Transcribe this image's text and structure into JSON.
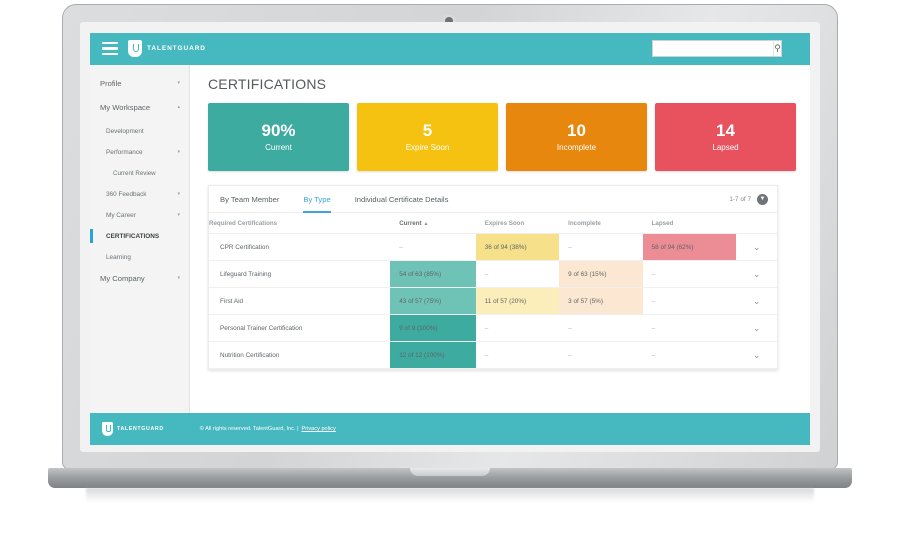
{
  "topbar": {
    "menu_icon": "hamburger-icon",
    "brand_icon": "shield-icon",
    "brand_name": "TALENTGUARD",
    "search_placeholder": "",
    "search_value": "",
    "search_icon": "search-icon"
  },
  "sidebar": {
    "items": [
      {
        "label": "Profile",
        "level": "top",
        "caret": "▾",
        "active": false
      },
      {
        "label": "My Workspace",
        "level": "top",
        "caret": "▴",
        "active": false
      },
      {
        "label": "Development",
        "level": "sub",
        "caret": "",
        "active": false
      },
      {
        "label": "Performance",
        "level": "sub",
        "caret": "▾",
        "active": false
      },
      {
        "label": "Current Review",
        "level": "sub2",
        "caret": "",
        "active": false
      },
      {
        "label": "360 Feedback",
        "level": "sub",
        "caret": "▾",
        "active": false
      },
      {
        "label": "My Career",
        "level": "sub",
        "caret": "▾",
        "active": false
      },
      {
        "label": "CERTIFICATIONS",
        "level": "sub",
        "caret": "",
        "active": true
      },
      {
        "label": "Learning",
        "level": "sub",
        "caret": "",
        "active": false
      },
      {
        "label": "My Company",
        "level": "top",
        "caret": "▾",
        "active": false
      }
    ]
  },
  "main": {
    "page_title": "CERTIFICATIONS",
    "kpi_cards": [
      {
        "value": "90%",
        "label": "Current",
        "color": "#3dab9f"
      },
      {
        "value": "5",
        "label": "Expire Soon",
        "color": "#f5c211"
      },
      {
        "value": "10",
        "label": "Incomplete",
        "color": "#e8870d"
      },
      {
        "value": "14",
        "label": "Lapsed",
        "color": "#e8525e"
      }
    ],
    "tabs": [
      {
        "label": "By Team Member",
        "active": false
      },
      {
        "label": "By Type",
        "active": true
      },
      {
        "label": "Individual Certificate Details",
        "active": false
      }
    ],
    "pagination": {
      "label": "1-7 of 7",
      "toggle_icon": "chevron-down-icon"
    },
    "table": {
      "columns": [
        {
          "label": "Required Certifications",
          "sorted": false
        },
        {
          "label": "Current",
          "sorted": true,
          "sort_caret": "▲"
        },
        {
          "label": "Expires Soon",
          "sorted": false
        },
        {
          "label": "Incomplete",
          "sorted": false
        },
        {
          "label": "Lapsed",
          "sorted": false
        }
      ],
      "dash": "–",
      "row_expand_icon": "chevron-down-icon",
      "rows": [
        {
          "name": "CPR Certification",
          "current": {
            "text": "–",
            "tint": "none"
          },
          "expires_soon": {
            "text": "36 of 94 (38%)",
            "tint": "expires"
          },
          "incomplete": {
            "text": "–",
            "tint": "none"
          },
          "lapsed": {
            "text": "58 of 94 (62%)",
            "tint": "lapsed"
          }
        },
        {
          "name": "Lifeguard Training",
          "current": {
            "text": "54 of 63 (85%)",
            "tint": "current-2"
          },
          "expires_soon": {
            "text": "–",
            "tint": "none"
          },
          "incomplete": {
            "text": "9 of 63 (15%)",
            "tint": "incomp"
          },
          "lapsed": {
            "text": "–",
            "tint": "none"
          }
        },
        {
          "name": "First Aid",
          "current": {
            "text": "43 of 57 (75%)",
            "tint": "current-2"
          },
          "expires_soon": {
            "text": "11 of 57 (20%)",
            "tint": "expires-2"
          },
          "incomplete": {
            "text": "3 of 57 (5%)",
            "tint": "incomp"
          },
          "lapsed": {
            "text": "–",
            "tint": "none"
          }
        },
        {
          "name": "Personal Trainer Certification",
          "current": {
            "text": "9 of 9 (100%)",
            "tint": "current"
          },
          "expires_soon": {
            "text": "–",
            "tint": "none"
          },
          "incomplete": {
            "text": "–",
            "tint": "none"
          },
          "lapsed": {
            "text": "–",
            "tint": "none"
          }
        },
        {
          "name": "Nutrition Certification",
          "current": {
            "text": "12 of 12 (100%)",
            "tint": "current"
          },
          "expires_soon": {
            "text": "–",
            "tint": "none"
          },
          "incomplete": {
            "text": "–",
            "tint": "none"
          },
          "lapsed": {
            "text": "–",
            "tint": "none"
          }
        }
      ]
    }
  },
  "footer": {
    "brand_icon": "shield-icon",
    "brand_name": "TALENTGUARD",
    "copyright": "© All rights reserved. TalentGuard, Inc. |",
    "privacy_link": "Privacy policy"
  }
}
